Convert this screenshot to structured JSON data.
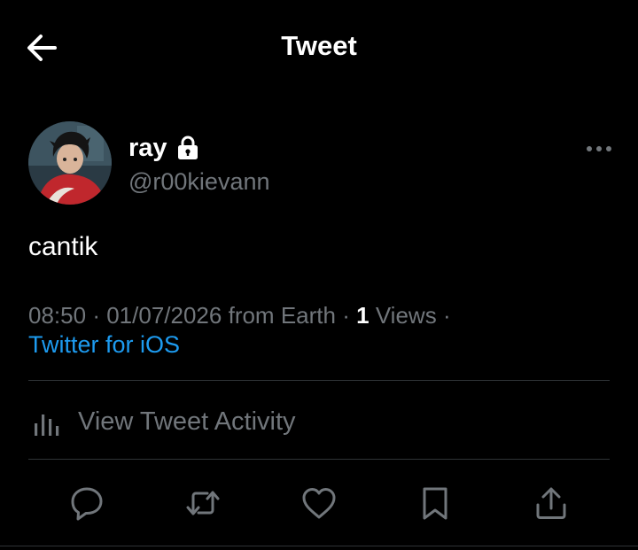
{
  "header": {
    "title": "Tweet",
    "back_icon": "arrow-left-icon"
  },
  "author": {
    "display_name": "ray",
    "handle": "@r00kievann",
    "protected_icon": "lock-icon",
    "avatar_icon": "avatar-image"
  },
  "tweet": {
    "text": "cantik",
    "time": "08:50",
    "date": "01/07/2026",
    "location": "from Earth",
    "views_count": "1",
    "views_label": "Views",
    "separator": "·",
    "source": "Twitter for iOS"
  },
  "activity": {
    "label": "View Tweet Activity",
    "icon": "analytics-icon"
  },
  "actions": [
    {
      "name": "reply",
      "icon": "reply-icon"
    },
    {
      "name": "retweet",
      "icon": "retweet-icon"
    },
    {
      "name": "like",
      "icon": "heart-icon"
    },
    {
      "name": "bookmark",
      "icon": "bookmark-icon"
    },
    {
      "name": "share",
      "icon": "share-icon"
    }
  ],
  "colors": {
    "background": "#000000",
    "primary_text": "#ffffff",
    "secondary_text": "#71767b",
    "link": "#1d9bf0",
    "divider": "#2f3336"
  }
}
